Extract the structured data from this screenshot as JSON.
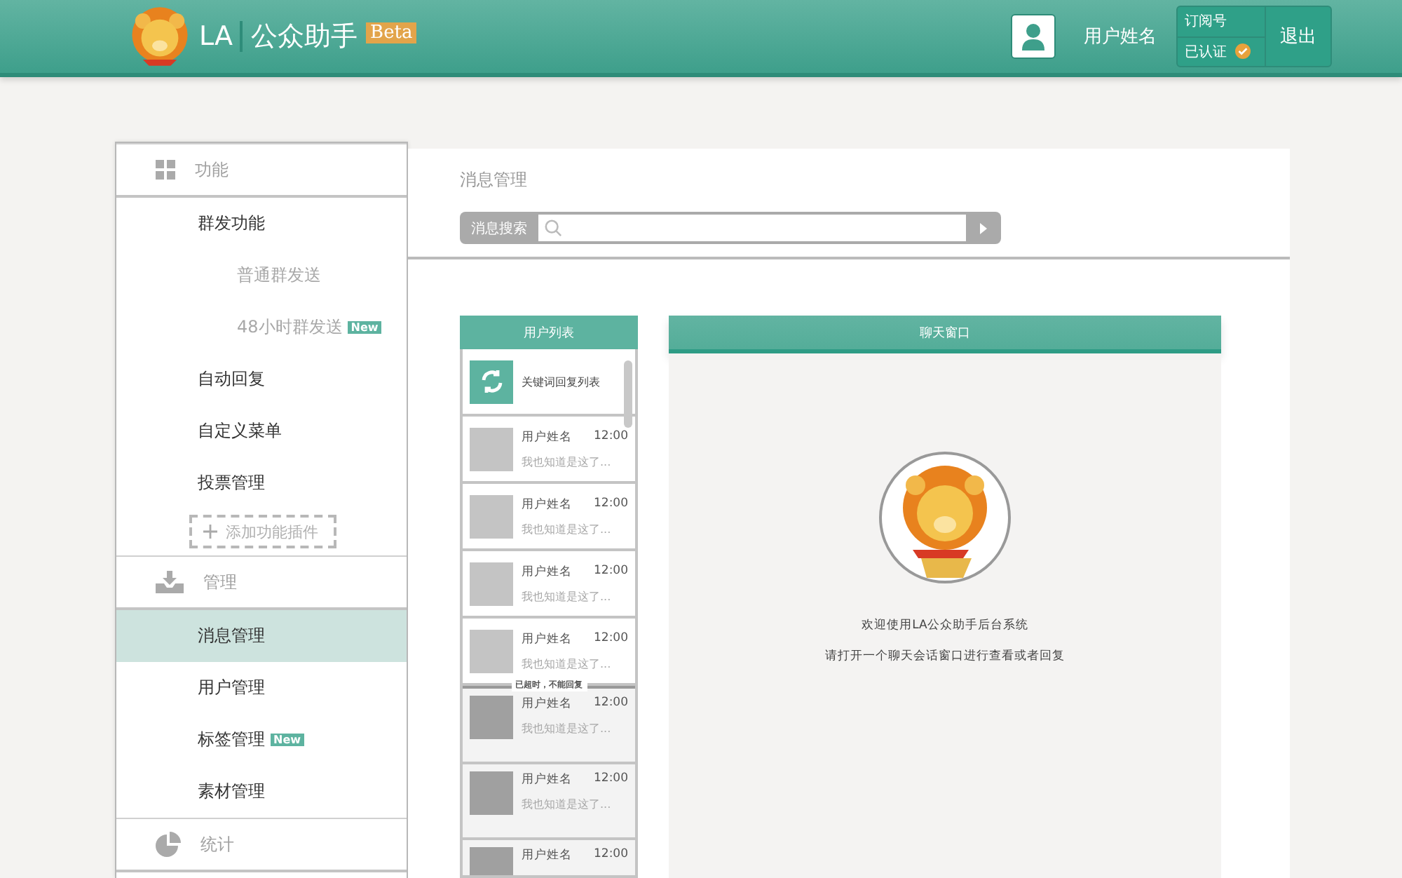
{
  "header": {
    "logo_text": "LA",
    "app_name": "公众助手",
    "badge": "Beta",
    "user_name": "用户姓名",
    "account_type": "订阅号",
    "verified": "已认证",
    "logout": "退出"
  },
  "sidebar": [
    {
      "kind": "section",
      "label": "功能"
    },
    {
      "kind": "item",
      "label": "群发功能",
      "selected": false,
      "children": [
        {
          "label": "普通群发送",
          "selected": false
        },
        {
          "label": "48小时群发送",
          "badge": "New",
          "selected": false
        }
      ]
    },
    {
      "kind": "item",
      "label": "自动回复",
      "selected": false
    },
    {
      "kind": "item",
      "label": "自定义菜单",
      "selected": false
    },
    {
      "kind": "item",
      "label": "投票管理",
      "selected": false
    },
    {
      "kind": "add",
      "label": "添加功能插件"
    },
    {
      "kind": "section",
      "label": "管理"
    },
    {
      "kind": "item",
      "label": "消息管理",
      "selected": true
    },
    {
      "kind": "item",
      "label": "用户管理",
      "selected": false
    },
    {
      "kind": "item",
      "label": "标签管理",
      "badge": "New",
      "selected": false
    },
    {
      "kind": "item",
      "label": "素材管理",
      "selected": false
    },
    {
      "kind": "section",
      "label": "统计"
    }
  ],
  "main": {
    "title": "消息管理",
    "search": {
      "label": "消息搜索"
    },
    "user_list": {
      "title": "用户列表",
      "items": [
        {
          "kind": "keyword",
          "label": "关键词回复列表"
        },
        {
          "kind": "user",
          "name": "用户姓名",
          "time": "12:00",
          "preview": "我也知道是这了...",
          "expired": false
        },
        {
          "kind": "user",
          "name": "用户姓名",
          "time": "12:00",
          "preview": "我也知道是这了...",
          "expired": false
        },
        {
          "kind": "user",
          "name": "用户姓名",
          "time": "12:00",
          "preview": "我也知道是这了...",
          "expired": false
        },
        {
          "kind": "user",
          "name": "用户姓名",
          "time": "12:00",
          "preview": "我也知道是这了...",
          "expired": false
        },
        {
          "kind": "divider",
          "label": "已超时，不能回复"
        },
        {
          "kind": "user",
          "name": "用户姓名",
          "time": "12:00",
          "preview": "我也知道是这了...",
          "expired": true
        },
        {
          "kind": "user",
          "name": "用户姓名",
          "time": "12:00",
          "preview": "我也知道是这了...",
          "expired": true
        },
        {
          "kind": "user",
          "name": "用户姓名",
          "time": "12:00",
          "expired": true
        }
      ]
    },
    "chat": {
      "title": "聊天窗口",
      "welcome": "欢迎使用LA公众助手后台系统",
      "hint": "请打开一个聊天会话窗口进行查看或者回复"
    }
  }
}
